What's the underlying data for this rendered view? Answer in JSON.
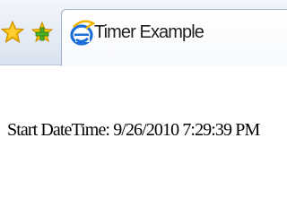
{
  "toolbar": {
    "favorites_icon": "star-icon",
    "add_favorites_icon": "add-favorite-icon",
    "colors": {
      "star": "#f5b400",
      "add": "#4caf2a"
    }
  },
  "tab": {
    "icon": "ie-icon",
    "title": "Timer Example"
  },
  "page": {
    "label": "Start DateTime:",
    "value": "9/26/2010 7:29:39 PM"
  }
}
